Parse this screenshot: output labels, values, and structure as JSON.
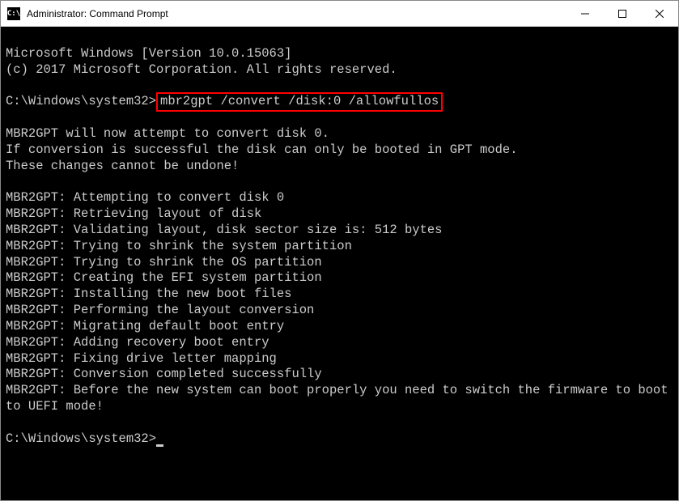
{
  "titlebar": {
    "icon_label": "C:\\",
    "title": "Administrator: Command Prompt"
  },
  "terminal": {
    "line1": "Microsoft Windows [Version 10.0.15063]",
    "line2": "(c) 2017 Microsoft Corporation. All rights reserved.",
    "prompt1_prefix": "C:\\Windows\\system32>",
    "prompt1_cmd": "mbr2gpt /convert /disk:0 /allowfullos",
    "msg1": "MBR2GPT will now attempt to convert disk 0.",
    "msg2": "If conversion is successful the disk can only be booted in GPT mode.",
    "msg3": "These changes cannot be undone!",
    "out1": "MBR2GPT: Attempting to convert disk 0",
    "out2": "MBR2GPT: Retrieving layout of disk",
    "out3": "MBR2GPT: Validating layout, disk sector size is: 512 bytes",
    "out4": "MBR2GPT: Trying to shrink the system partition",
    "out5": "MBR2GPT: Trying to shrink the OS partition",
    "out6": "MBR2GPT: Creating the EFI system partition",
    "out7": "MBR2GPT: Installing the new boot files",
    "out8": "MBR2GPT: Performing the layout conversion",
    "out9": "MBR2GPT: Migrating default boot entry",
    "out10": "MBR2GPT: Adding recovery boot entry",
    "out11": "MBR2GPT: Fixing drive letter mapping",
    "out12": "MBR2GPT: Conversion completed successfully",
    "out13": "MBR2GPT: Before the new system can boot properly you need to switch the firmware to boot to UEFI mode!",
    "prompt2": "C:\\Windows\\system32>"
  }
}
